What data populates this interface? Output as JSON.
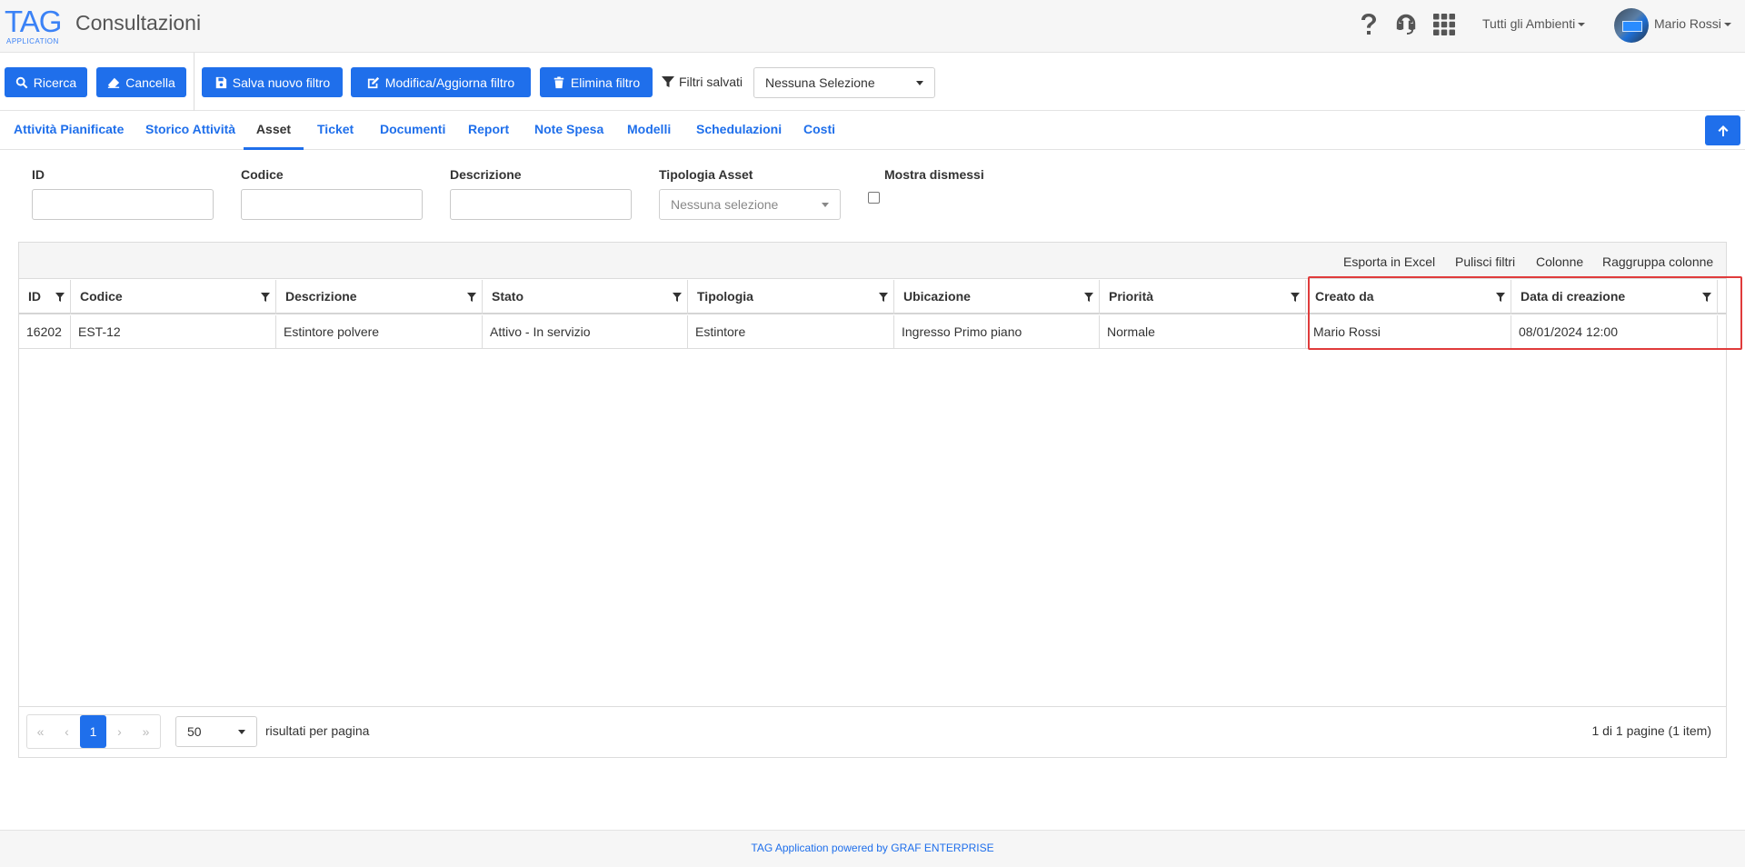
{
  "header": {
    "logo_text": "TAG",
    "logo_sub": "APPLICATION",
    "title": "Consultazioni",
    "icons": [
      "help-icon",
      "headset-icon",
      "apps-grid-icon"
    ],
    "environment": "Tutti gli Ambienti",
    "user": "Mario Rossi"
  },
  "toolbar": {
    "search_label": "Ricerca",
    "clear_label": "Cancella",
    "save_filter_label": "Salva nuovo filtro",
    "edit_filter_label": "Modifica/Aggiorna filtro",
    "delete_filter_label": "Elimina filtro",
    "saved_filters_label": "Filtri salvati",
    "saved_filters_value": "Nessuna Selezione"
  },
  "tabs": [
    {
      "label": "Attività Pianificate"
    },
    {
      "label": "Storico Attività"
    },
    {
      "label": "Asset",
      "active": true
    },
    {
      "label": "Ticket"
    },
    {
      "label": "Documenti"
    },
    {
      "label": "Report"
    },
    {
      "label": "Note Spesa"
    },
    {
      "label": "Modelli"
    },
    {
      "label": "Schedulazioni"
    },
    {
      "label": "Costi"
    }
  ],
  "filters": {
    "id_label": "ID",
    "id_value": "",
    "code_label": "Codice",
    "code_value": "",
    "desc_label": "Descrizione",
    "desc_value": "",
    "type_label": "Tipologia Asset",
    "type_placeholder": "Nessuna selezione",
    "dismissed_label": "Mostra dismessi",
    "dismissed_checked": false
  },
  "grid": {
    "toolbar": {
      "export": "Esporta in Excel",
      "clear_filters": "Pulisci filtri",
      "columns": "Colonne",
      "group_columns": "Raggruppa colonne"
    },
    "columns": [
      "ID",
      "Codice",
      "Descrizione",
      "Stato",
      "Tipologia",
      "Ubicazione",
      "Priorità",
      "Creato da",
      "Data di creazione"
    ],
    "rows": [
      [
        "16202",
        "EST-12",
        "Estintore polvere",
        "Attivo - In servizio",
        "Estintore",
        "Ingresso Primo piano",
        "Normale",
        "Mario Rossi",
        "08/01/2024 12:00"
      ]
    ],
    "pager": {
      "current_page": "1",
      "page_size": "50",
      "page_size_label": "risultati per pagina",
      "info": "1 di 1 pagine (1 item)"
    }
  },
  "footer": {
    "text": "TAG Application powered by GRAF ENTERPRISE"
  },
  "colors": {
    "accent": "#1f6feb",
    "highlight": "#e03b3b"
  }
}
